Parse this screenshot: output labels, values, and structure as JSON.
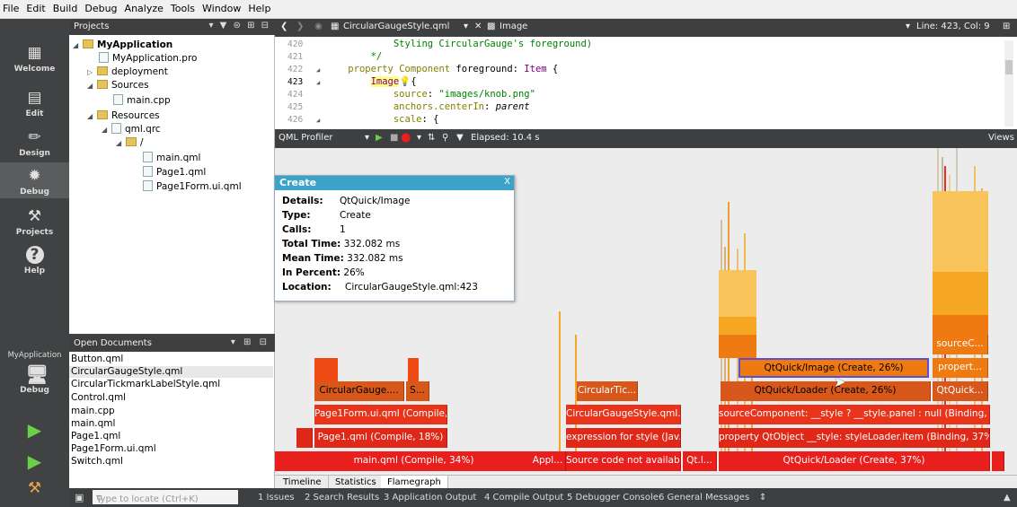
{
  "menu": [
    "File",
    "Edit",
    "Build",
    "Debug",
    "Analyze",
    "Tools",
    "Window",
    "Help"
  ],
  "modes": [
    {
      "label": "Welcome",
      "icon": "grid-icon"
    },
    {
      "label": "Edit",
      "icon": "document-icon"
    },
    {
      "label": "Design",
      "icon": "pen-icon"
    },
    {
      "label": "Debug",
      "icon": "bug-icon"
    },
    {
      "label": "Projects",
      "icon": "wrench-icon"
    },
    {
      "label": "Help",
      "icon": "help-icon"
    }
  ],
  "kit": {
    "project": "MyApplication",
    "label": "Debug"
  },
  "projects": {
    "title": "Projects",
    "tree": [
      {
        "text": "MyApplication",
        "bold": true
      },
      {
        "text": "MyApplication.pro"
      },
      {
        "text": "deployment"
      },
      {
        "text": "Sources"
      },
      {
        "text": "main.cpp"
      },
      {
        "text": "Resources"
      },
      {
        "text": "qml.qrc"
      },
      {
        "text": "/"
      },
      {
        "text": "main.qml"
      },
      {
        "text": "Page1.qml"
      },
      {
        "text": "Page1Form.ui.qml"
      }
    ]
  },
  "open_documents": {
    "title": "Open Documents",
    "items": [
      "Button.qml",
      "CircularGaugeStyle.qml",
      "CircularTickmarkLabelStyle.qml",
      "Control.qml",
      "main.cpp",
      "main.qml",
      "Page1.qml",
      "Page1Form.ui.qml",
      "Switch.qml"
    ],
    "selected": 1
  },
  "editor": {
    "file": "CircularGaugeStyle.qml",
    "symbol": "Image",
    "position": "Line: 423, Col: 9",
    "lines": [
      {
        "n": "420",
        "code": "            Styling CircularGauge's foreground)"
      },
      {
        "n": "421",
        "code": "        */"
      },
      {
        "n": "422",
        "code": "    property Component foreground: Item {"
      },
      {
        "n": "423",
        "code": "        Image {"
      },
      {
        "n": "424",
        "code": "            source: \"images/knob.png\""
      },
      {
        "n": "425",
        "code": "            anchors.centerIn: parent"
      },
      {
        "n": "426",
        "code": "            scale: {"
      }
    ]
  },
  "profiler": {
    "title": "QML Profiler",
    "elapsed": "Elapsed:  10.4 s",
    "views": "Views"
  },
  "popup": {
    "title": "Create",
    "close": "X",
    "rows": [
      {
        "k": "Details:",
        "v": "QtQuick/Image"
      },
      {
        "k": "Type:",
        "v": "Create"
      },
      {
        "k": "Calls:",
        "v": "1"
      },
      {
        "k": "Total Time:",
        "v": "332.082 ms"
      },
      {
        "k": "Mean Time:",
        "v": "332.082 ms"
      },
      {
        "k": "In Percent:",
        "v": "26%"
      },
      {
        "k": "Location:",
        "v": "CircularGaugeStyle.qml:423"
      }
    ]
  },
  "flame": {
    "colors": {
      "red": "#e81f1c",
      "orange": "#ee4a14",
      "deep": "#e02818",
      "brown": "#d8571b",
      "amber": "#f07a12",
      "yellow": "#f5a623",
      "pale": "#f9c45a"
    },
    "labels": {
      "main": "main.qml (Compile, 34%)",
      "appl": "Appl...",
      "source": "Source code not availab...",
      "qtl": "Qt.l...",
      "loader37": "QtQuick/Loader (Create, 37%)",
      "page1": "Page1.qml (Compile, 18%)",
      "expr": "expression for style (Jav...",
      "propqt": "property QtObject __style: styleLoader.item (Binding, 37%)",
      "page1form": "Page1Form.ui.qml (Compile,...",
      "cgstyle": "CircularGaugeStyle.qml...",
      "sourcecomp": "sourceComponent: __style ? __style.panel : null (Binding, 3...",
      "cgauge": "CircularGauge....",
      "s": "S...",
      "circtic": "CircularTic...",
      "loader26": "QtQuick/Loader (Create, 26%)",
      "qtquick": "QtQuick...",
      "image26": "QtQuick/Image (Create, 26%)",
      "propert": "propert...",
      "sourcec": "sourceC..."
    }
  },
  "view_tabs": [
    "Timeline",
    "Statistics",
    "Flamegraph"
  ],
  "status": {
    "locate_placeholder": "Type to locate (Ctrl+K)",
    "panes": [
      "1 Issues",
      "2 Search Results",
      "3 Application Output",
      "4 Compile Output",
      "5 Debugger Console",
      "6 General Messages"
    ]
  }
}
